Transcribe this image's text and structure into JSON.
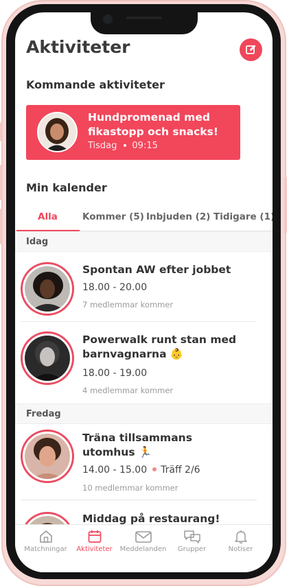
{
  "header": {
    "title": "Aktiviteter"
  },
  "upcoming": {
    "section_title": "Kommande aktiviteter",
    "card": {
      "title": "Hundpromenad med fikastopp och snacks!",
      "day": "Tisdag",
      "time": "09:15"
    }
  },
  "calendar": {
    "section_title": "Min kalender",
    "tabs": [
      {
        "label": "Alla"
      },
      {
        "label": "Kommer (5)"
      },
      {
        "label": "Inbjuden (2)"
      },
      {
        "label": "Tidigare (1)"
      }
    ],
    "days": [
      {
        "label": "Idag",
        "events": [
          {
            "title": "Spontan AW efter jobbet",
            "time": "18.00 - 20.00",
            "members": "7 medlemmar kommer"
          },
          {
            "title": "Powerwalk runt stan med barnvagnarna 👶",
            "time": "18.00 - 19.00",
            "members": "4 medlemmar kommer"
          }
        ]
      },
      {
        "label": "Fredag",
        "events": [
          {
            "title": "Träna tillsammans utomhus 🏃",
            "time": "14.00 - 15.00",
            "extra": "Träff 2/6",
            "members": "10 medlemmar kommer"
          },
          {
            "title": "Middag på restaurang!"
          }
        ]
      }
    ]
  },
  "tabbar": {
    "items": [
      {
        "label": "Matchningar"
      },
      {
        "label": "Aktiviteter"
      },
      {
        "label": "Meddelanden"
      },
      {
        "label": "Grupper"
      },
      {
        "label": "Notiser"
      }
    ]
  },
  "colors": {
    "accent": "#f0475a",
    "frame": "#f7d9d6"
  }
}
